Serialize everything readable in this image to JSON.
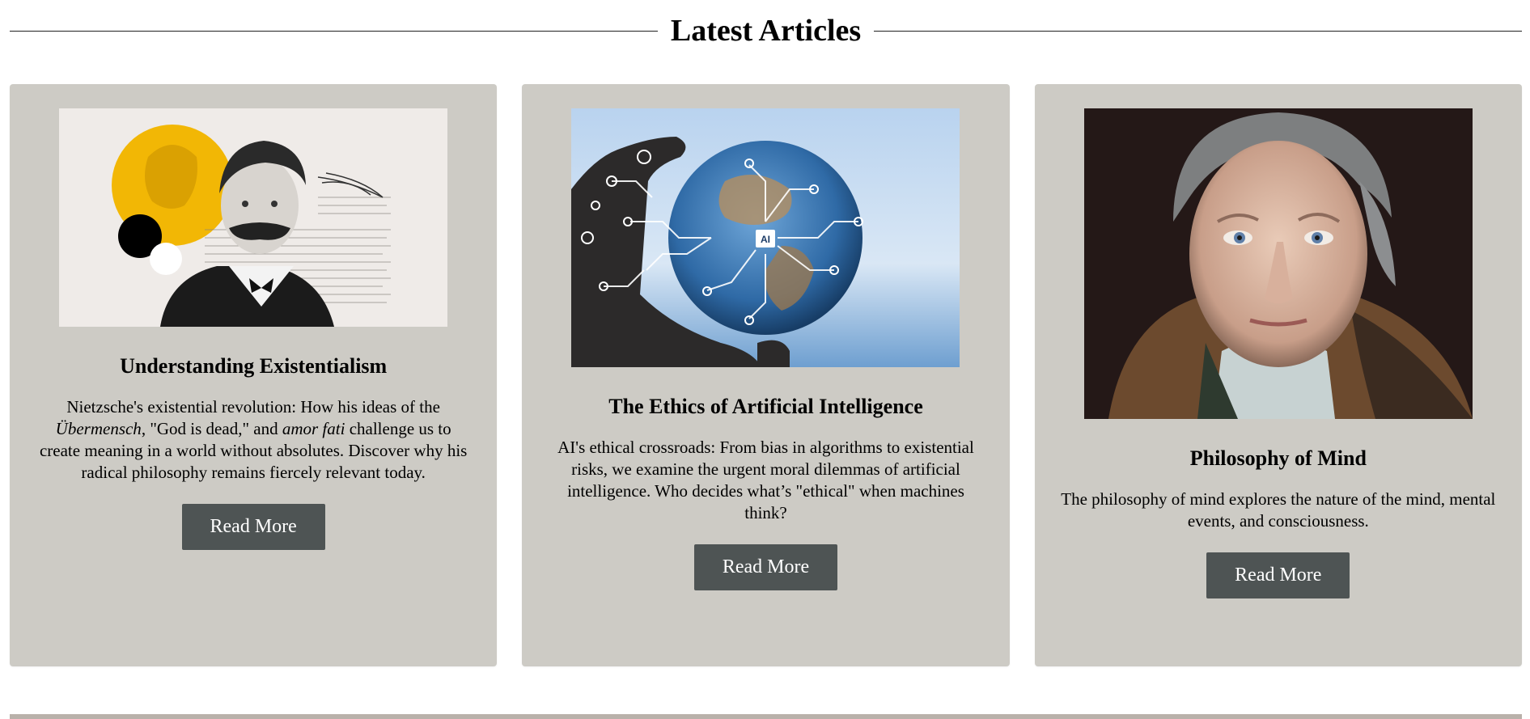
{
  "section": {
    "title": "Latest Articles"
  },
  "cards": [
    {
      "title": "Understanding Existentialism",
      "text_parts": [
        "Nietzsche's existential revolution: How his ideas of the ",
        "Übermensch",
        ", \"God is dead,\" and ",
        "amor fati",
        " challenge us to create meaning in a world without absolutes. Discover why his radical philosophy remains fiercely relevant today."
      ],
      "button": "Read More",
      "image_icon": "nietzsche-collage-image"
    },
    {
      "title": "The Ethics of Artificial Intelligence",
      "text": "AI's ethical crossroads: From bias in algorithms to existential risks, we examine the urgent moral dilemmas of artificial intelligence. Who decides what’s \"ethical\" when machines think?",
      "button": "Read More",
      "image_label": "AI",
      "image_icon": "ai-globe-image"
    },
    {
      "title": "Philosophy of Mind",
      "text": "The philosophy of mind explores the nature of the mind, mental events, and consciousness.",
      "button": "Read More",
      "image_icon": "hegel-portrait-image"
    }
  ],
  "colors": {
    "card_bg": "#cdcbc5",
    "button_bg": "#4e5454",
    "accent_yellow": "#f2b705",
    "footer_strip": "#b9b1aa"
  }
}
